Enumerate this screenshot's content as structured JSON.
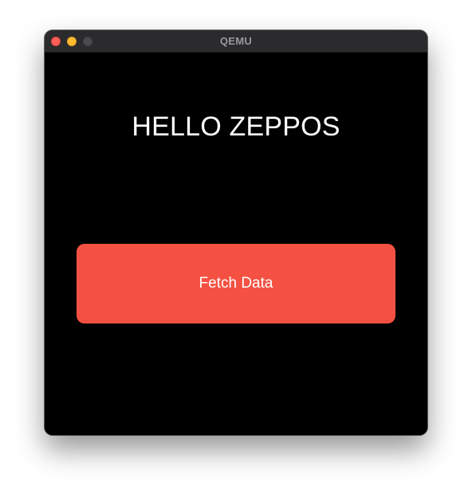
{
  "window": {
    "title": "QEMU",
    "controls": {
      "close": "close-button",
      "minimize": "minimize-button",
      "zoom": "zoom-button"
    }
  },
  "app": {
    "heading": "HELLO ZEPPOS",
    "fetch_button_label": "Fetch Data"
  },
  "colors": {
    "background": "#000000",
    "button": "#f45142",
    "text": "#ffffff",
    "titlebar": "#2b2b2d"
  }
}
